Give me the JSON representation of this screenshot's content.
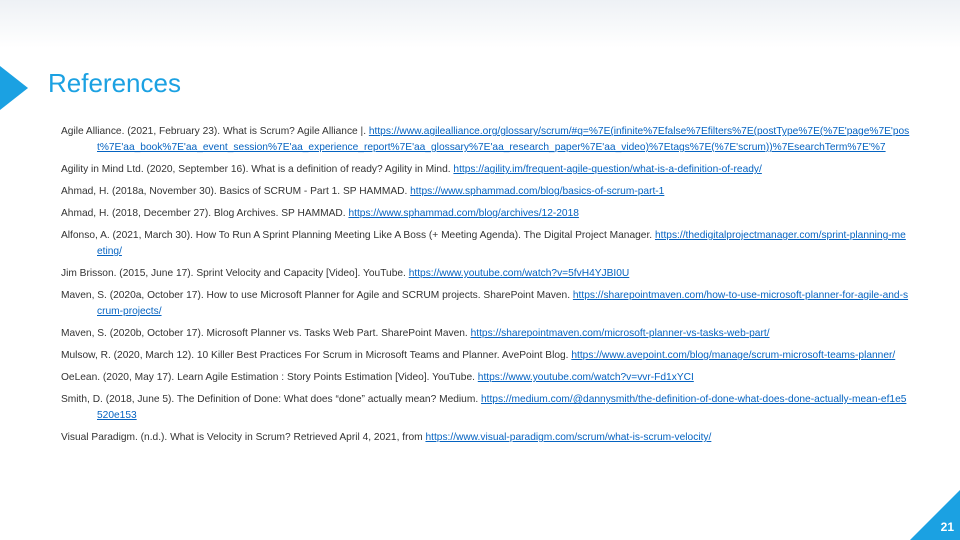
{
  "slide": {
    "title": "References",
    "page_number": "21",
    "accent_color": "#1ba1e2",
    "link_color": "#0563c1"
  },
  "references": [
    {
      "text": "Agile Alliance. (2021, February 23). What is Scrum? Agile Alliance |. ",
      "link": "https://www.agilealliance.org/glossary/scrum/#q=%7E(infinite%7Efalse%7Efilters%7E(postType%7E(%7E'page%7E'post%7E'aa_book%7E'aa_event_session%7E'aa_experience_report%7E'aa_glossary%7E'aa_research_paper%7E'aa_video)%7Etags%7E(%7E'scrum))%7EsearchTerm%7E'%7"
    },
    {
      "text": "Agility in Mind Ltd. (2020, September 16). What is a definition of ready? Agility in Mind. ",
      "link": "https://agility.im/frequent-agile-question/what-is-a-definition-of-ready/"
    },
    {
      "text": "Ahmad, H. (2018a, November 30). Basics of SCRUM - Part 1. SP HAMMAD. ",
      "link": "https://www.sphammad.com/blog/basics-of-scrum-part-1"
    },
    {
      "text": "Ahmad, H. (2018, December 27). Blog Archives. SP HAMMAD. ",
      "link": "https://www.sphammad.com/blog/archives/12-2018"
    },
    {
      "text": "Alfonso, A. (2021, March 30). How To Run A Sprint Planning Meeting Like A Boss (+ Meeting Agenda). The Digital Project Manager. ",
      "link": "https://thedigitalprojectmanager.com/sprint-planning-meeting/"
    },
    {
      "text": "Jim Brisson. (2015, June 17). Sprint Velocity and Capacity [Video]. YouTube. ",
      "link": "https://www.youtube.com/watch?v=5fvH4YJBI0U"
    },
    {
      "text": "Maven, S. (2020a, October 17). How to use Microsoft Planner for Agile and SCRUM projects. SharePoint Maven. ",
      "link": "https://sharepointmaven.com/how-to-use-microsoft-planner-for-agile-and-scrum-projects/"
    },
    {
      "text": "Maven, S. (2020b, October 17). Microsoft Planner vs. Tasks Web Part. SharePoint Maven. ",
      "link": "https://sharepointmaven.com/microsoft-planner-vs-tasks-web-part/"
    },
    {
      "text": "Mulsow, R. (2020, March 12). 10 Killer Best Practices For Scrum in Microsoft Teams and Planner. AvePoint Blog. ",
      "link": "https://www.avepoint.com/blog/manage/scrum-microsoft-teams-planner/"
    },
    {
      "text": "OeLean. (2020, May 17). Learn Agile Estimation : Story Points Estimation [Video]. YouTube. ",
      "link": "https://www.youtube.com/watch?v=vvr-Fd1xYCI"
    },
    {
      "text": "Smith, D. (2018, June 5). The Definition of Done: What does “done” actually mean? Medium. ",
      "link": "https://medium.com/@dannysmith/the-definition-of-done-what-does-done-actually-mean-ef1e5520e153"
    },
    {
      "text": "Visual Paradigm. (n.d.). What is Velocity in Scrum? Retrieved April 4, 2021, from ",
      "link": "https://www.visual-paradigm.com/scrum/what-is-scrum-velocity/"
    }
  ]
}
